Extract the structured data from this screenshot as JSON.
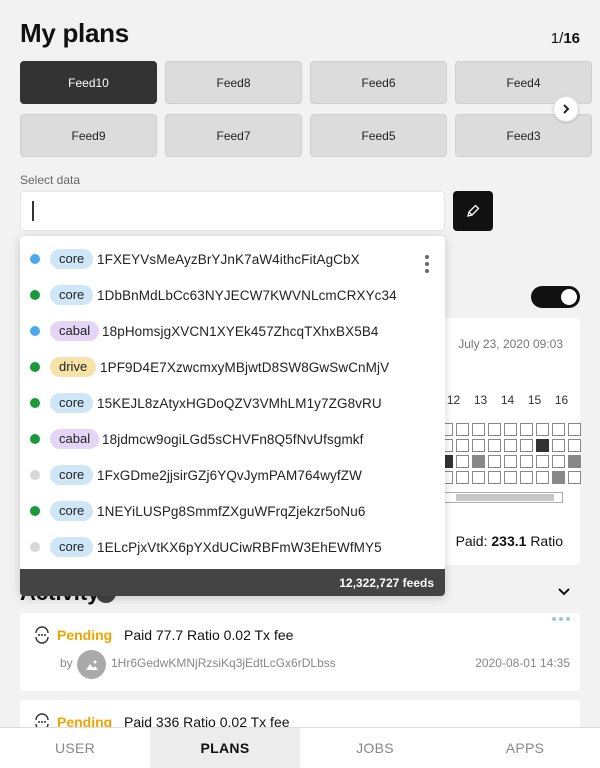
{
  "header": {
    "title": "My plans",
    "pager_current": "1",
    "pager_sep": "/",
    "pager_total": "16"
  },
  "feeds": [
    "Feed10",
    "Feed8",
    "Feed6",
    "Feed4",
    "Feed9",
    "Feed7",
    "Feed5",
    "Feed3"
  ],
  "select": {
    "label": "Select data",
    "value": ""
  },
  "dropdown": {
    "items": [
      {
        "tag": "core",
        "address": "1FXEYVsMeAyzBrYJnK7aW4ithcFitAgCbX",
        "dot": "#4aa8f0",
        "tag_color": "#cfe6f7"
      },
      {
        "tag": "core",
        "address": "1DbBnMdLbCc63NYJECW7KWVNLcmCRXYc34",
        "dot": "#1a9a3a",
        "tag_color": "#cfe6f7"
      },
      {
        "tag": "cabal",
        "address": "18pHomsjgXVCN1XYEk457ZhcqTXhxBX5B4",
        "dot": "#4aa8f0",
        "tag_color": "#e4d4f5"
      },
      {
        "tag": "drive",
        "address": "1PF9D4E7XzwcmxyMBjwtD8SW8GwSwCnMjV",
        "dot": "#1a9a3a",
        "tag_color": "#f7e2a8"
      },
      {
        "tag": "core",
        "address": "15KEJL8zAtyxHGDoQZV3VMhLM1y7ZG8vRU",
        "dot": "#1a9a3a",
        "tag_color": "#cfe6f7"
      },
      {
        "tag": "cabal",
        "address": "18jdmcw9ogiLGd5sCHVFn8Q5fNvUfsgmkf",
        "dot": "#1a9a3a",
        "tag_color": "#e4d4f5"
      },
      {
        "tag": "core",
        "address": "1FxGDme2jjsirGZj6YQvJymPAM764wyfZW",
        "dot": "#d8d8d8",
        "tag_color": "#cfe6f7"
      },
      {
        "tag": "core",
        "address": "1NEYiLUSPg8SmmfZXguWFrqZjekzr5oNu6",
        "dot": "#1a9a3a",
        "tag_color": "#cfe6f7"
      },
      {
        "tag": "core",
        "address": "1ELcPjxVtKX6pYXdUCiwRBFmW3EhEWfMY5",
        "dot": "#d8d8d8",
        "tag_color": "#cfe6f7"
      }
    ],
    "footer": "12,322,727 feeds"
  },
  "plan_card": {
    "date": "July 23, 2020 09:03",
    "days": [
      "12",
      "13",
      "14",
      "15",
      "16"
    ],
    "paid_label": "Paid:",
    "paid_value": "233.1",
    "paid_unit": "Ratio"
  },
  "activity": {
    "title": "Activity",
    "items": [
      {
        "status": "Pending",
        "desc": "Paid 77.7 Ratio  0.02 Tx fee",
        "by": "by",
        "address": "1Hr6GedwKMNjRzsiKq3jEdtLcGx6rDLbss",
        "date": "2020-08-01 14:35"
      },
      {
        "status": "Pending",
        "desc": "Paid 336 Ratio  0.02 Tx fee"
      }
    ]
  },
  "nav": [
    "USER",
    "PLANS",
    "JOBS",
    "APPS"
  ]
}
